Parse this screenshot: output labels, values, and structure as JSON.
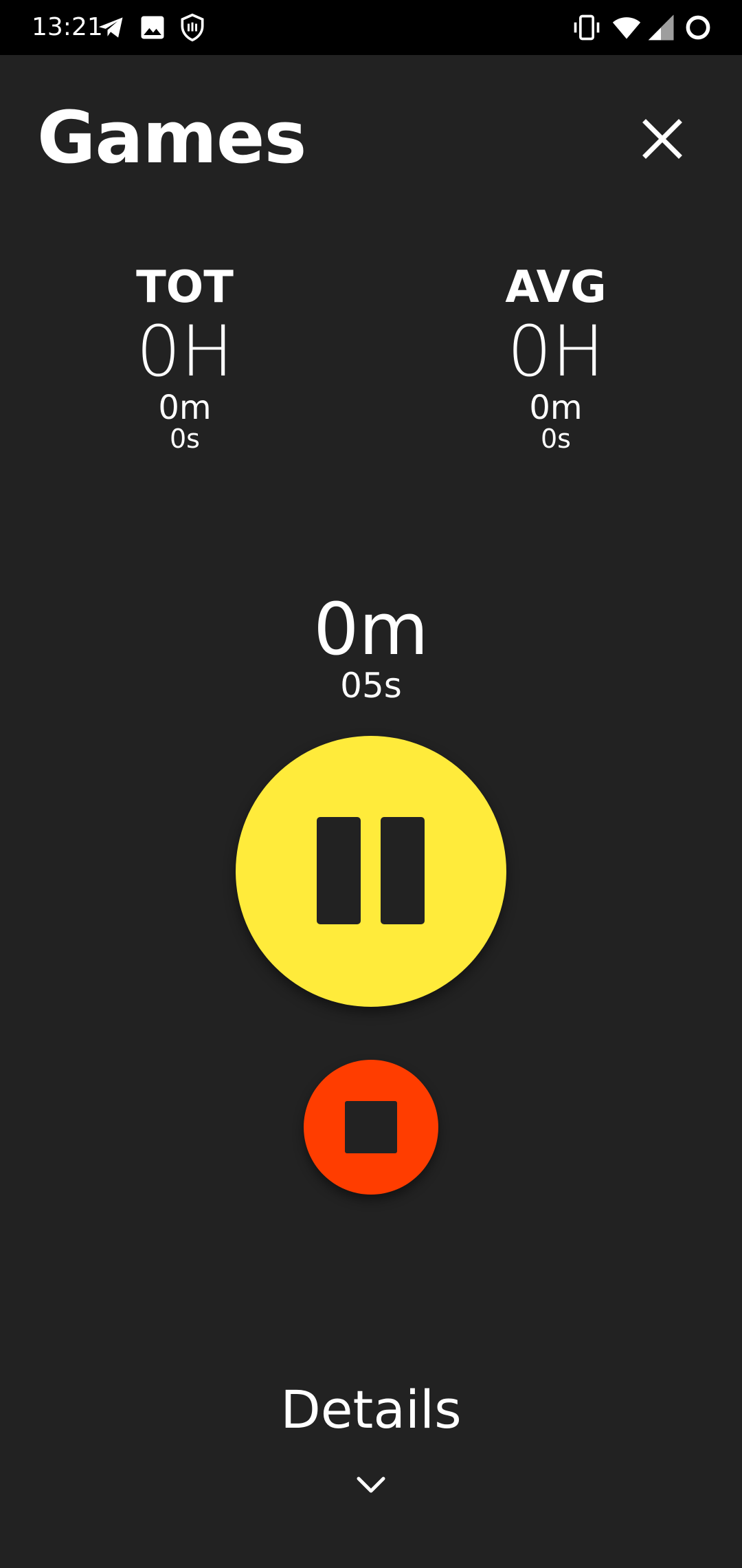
{
  "status_bar": {
    "time": "13:21",
    "left_icons": [
      "telegram-icon",
      "image-icon",
      "shield-icon"
    ],
    "right_icons": [
      "vibrate-icon",
      "wifi-icon",
      "signal-icon",
      "battery-saver-icon"
    ]
  },
  "header": {
    "title": "Games",
    "close_icon": "close-icon"
  },
  "stats": {
    "total": {
      "label": "TOT",
      "hours": "0H",
      "minutes": "0m",
      "seconds": "0s"
    },
    "average": {
      "label": "AVG",
      "hours": "0H",
      "minutes": "0m",
      "seconds": "0s"
    }
  },
  "timer": {
    "minutes": "0m",
    "seconds": "05s"
  },
  "controls": {
    "pause_icon": "pause-icon",
    "stop_icon": "stop-icon"
  },
  "colors": {
    "background": "#222222",
    "pause_button": "#ffeb3b",
    "stop_button": "#ff3d00",
    "text": "#ffffff"
  },
  "footer": {
    "details_label": "Details",
    "expand_icon": "chevron-down-icon"
  }
}
